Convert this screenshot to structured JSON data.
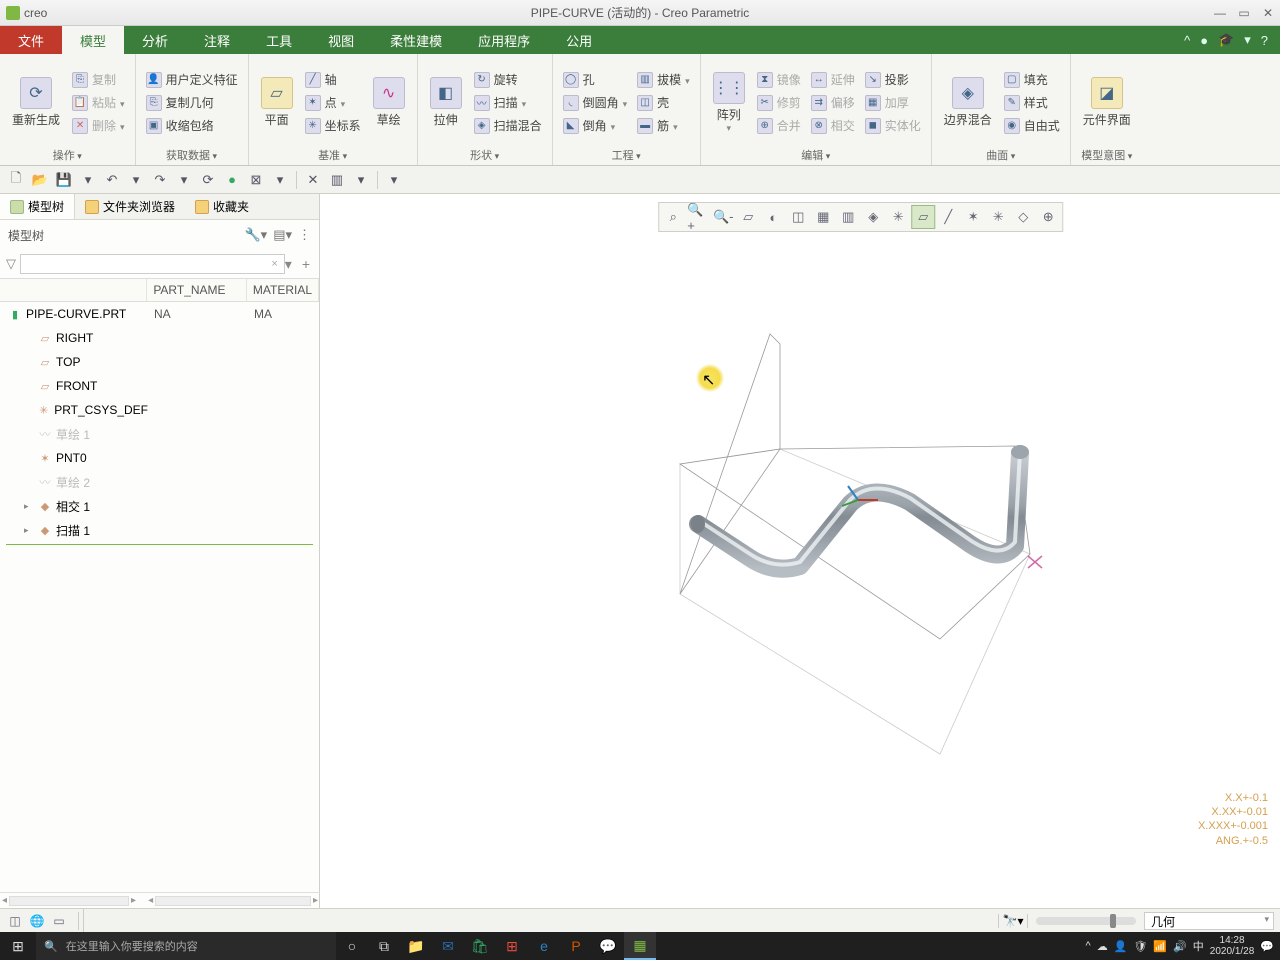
{
  "app": {
    "name": "creo",
    "doc_title": "PIPE-CURVE (活动的) - Creo Parametric"
  },
  "ribbon_tabs": {
    "file": "文件",
    "active": "模型",
    "others": [
      "分析",
      "注释",
      "工具",
      "视图",
      "柔性建模",
      "应用程序",
      "公用"
    ]
  },
  "ribbon": {
    "group1": {
      "regen": "重新生成",
      "copy": "复制",
      "paste": "粘贴",
      "delete": "删除",
      "label": "操作"
    },
    "group2": {
      "udf": "用户定义特征",
      "copygeom": "复制几何",
      "shrinkwrap": "收缩包络",
      "label": "获取数据"
    },
    "group3": {
      "plane": "平面",
      "axis": "轴",
      "point": "点",
      "csys": "坐标系",
      "sketch": "草绘",
      "label": "基准"
    },
    "group4": {
      "extrude": "拉伸",
      "revolve": "旋转",
      "sweep": "扫描",
      "sweepblend": "扫描混合",
      "label": "形状"
    },
    "group5": {
      "hole": "孔",
      "round": "倒圆角",
      "chamfer": "倒角",
      "draft": "拔模",
      "shell": "壳",
      "rib": "筋",
      "label": "工程"
    },
    "group6": {
      "pattern": "阵列",
      "mirror": "镜像",
      "trim": "修剪",
      "merge": "合并",
      "extend": "延伸",
      "offset": "偏移",
      "intersect": "相交",
      "project": "投影",
      "thicken": "加厚",
      "solidify": "实体化",
      "label": "编辑"
    },
    "group7": {
      "boundary": "边界混合",
      "fill": "填充",
      "style": "样式",
      "freestyle": "自由式",
      "label": "曲面"
    },
    "group8": {
      "component": "元件界面",
      "label": "模型意图"
    }
  },
  "panel": {
    "tabs": {
      "tree": "模型树",
      "browser": "文件夹浏览器",
      "fav": "收藏夹"
    },
    "header": "模型树",
    "columns": {
      "part": "PART_NAME",
      "material": "MATERIAL"
    },
    "root": {
      "name": "PIPE-CURVE.PRT",
      "part": "NA",
      "mat": "MA"
    },
    "items": [
      {
        "icon": "▱",
        "name": "RIGHT"
      },
      {
        "icon": "▱",
        "name": "TOP"
      },
      {
        "icon": "▱",
        "name": "FRONT"
      },
      {
        "icon": "✳",
        "name": "PRT_CSYS_DEF"
      },
      {
        "icon": "〰",
        "name": "草绘 1",
        "dim": true
      },
      {
        "icon": "✶",
        "name": "PNT0"
      },
      {
        "icon": "〰",
        "name": "草绘 2",
        "dim": true
      },
      {
        "icon": "◆",
        "name": "相交 1",
        "expandable": true
      },
      {
        "icon": "◆",
        "name": "扫描 1",
        "expandable": true
      }
    ]
  },
  "readout": {
    "l1": "X.X+-0.1",
    "l2": "X.XX+-0.01",
    "l3": "X.XXX+-0.001",
    "l4": "ANG.+-0.5"
  },
  "statusbar": {
    "selection_filter": "几何"
  },
  "taskbar": {
    "search_placeholder": "在这里输入你要搜索的内容",
    "time": "14:28",
    "date": "2020/1/28",
    "ime": "中"
  }
}
